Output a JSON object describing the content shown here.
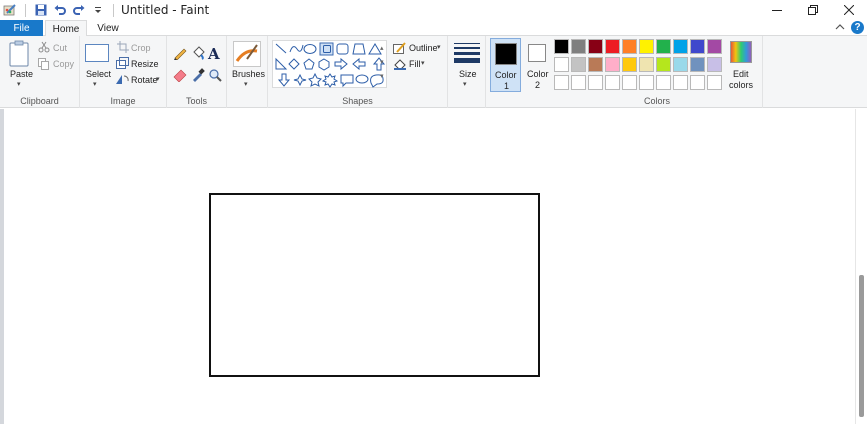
{
  "window": {
    "title": "Untitled - Faint"
  },
  "tabs": {
    "file": "File",
    "home": "Home",
    "view": "View"
  },
  "ribbon": {
    "clipboard": {
      "paste": "Paste",
      "cut": "Cut",
      "copy": "Copy",
      "group": "Clipboard"
    },
    "image": {
      "select": "Select",
      "crop": "Crop",
      "resize": "Resize",
      "rotate": "Rotate",
      "group": "Image"
    },
    "tools": {
      "group": "Tools"
    },
    "brushes": {
      "label": "Brushes"
    },
    "shapes": {
      "outline": "Outline",
      "fill": "Fill",
      "group": "Shapes"
    },
    "size": {
      "label": "Size"
    },
    "color1": {
      "line1": "Color",
      "line2": "1",
      "swatch": "#000000"
    },
    "color2": {
      "line1": "Color",
      "line2": "2",
      "swatch": "#ffffff"
    },
    "colors": {
      "group": "Colors",
      "palette_row1": [
        "#000000",
        "#7f7f7f",
        "#880015",
        "#ed1c24",
        "#ff7f27",
        "#fff200",
        "#22b14c",
        "#00a2e8",
        "#3f48cc",
        "#a349a4"
      ],
      "palette_row2": [
        "#ffffff",
        "#c3c3c3",
        "#b97a57",
        "#ffaec9",
        "#ffc90e",
        "#efe4b0",
        "#b5e61d",
        "#99d9ea",
        "#7092be",
        "#c8bfe7"
      ],
      "palette_row3": [
        "#ffffff",
        "#ffffff",
        "#ffffff",
        "#ffffff",
        "#ffffff",
        "#ffffff",
        "#ffffff",
        "#ffffff",
        "#ffffff",
        "#ffffff"
      ]
    },
    "edit_colors": {
      "line1": "Edit",
      "line2": "colors"
    }
  }
}
